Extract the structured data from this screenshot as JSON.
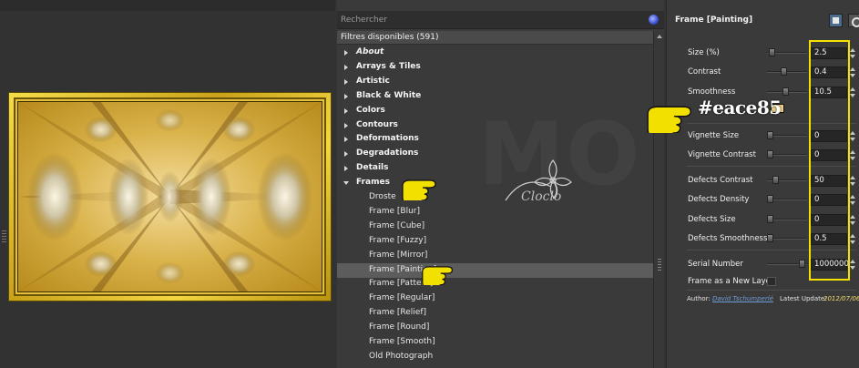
{
  "colors": {
    "accent_highlight": "#f5e000",
    "frame_gold": "#eace85",
    "link_blue": "#6f9bd8"
  },
  "filters": {
    "search_placeholder": "Rechercher",
    "header": "Filtres disponibles (591)",
    "items": [
      {
        "label": "About",
        "kind": "category",
        "italic": true
      },
      {
        "label": "Arrays & Tiles",
        "kind": "category"
      },
      {
        "label": "Artistic",
        "kind": "category"
      },
      {
        "label": "Black & White",
        "kind": "category"
      },
      {
        "label": "Colors",
        "kind": "category"
      },
      {
        "label": "Contours",
        "kind": "category"
      },
      {
        "label": "Deformations",
        "kind": "category"
      },
      {
        "label": "Degradations",
        "kind": "category"
      },
      {
        "label": "Details",
        "kind": "category"
      },
      {
        "label": "Frames",
        "kind": "category",
        "expanded": true
      },
      {
        "label": "Droste",
        "kind": "sub"
      },
      {
        "label": "Frame [Blur]",
        "kind": "sub"
      },
      {
        "label": "Frame [Cube]",
        "kind": "sub"
      },
      {
        "label": "Frame [Fuzzy]",
        "kind": "sub"
      },
      {
        "label": "Frame [Mirror]",
        "kind": "sub"
      },
      {
        "label": "Frame [Painting]",
        "kind": "sub",
        "selected": true
      },
      {
        "label": "Frame [Pattern]",
        "kind": "sub"
      },
      {
        "label": "Frame [Regular]",
        "kind": "sub"
      },
      {
        "label": "Frame [Relief]",
        "kind": "sub"
      },
      {
        "label": "Frame [Round]",
        "kind": "sub"
      },
      {
        "label": "Frame [Smooth]",
        "kind": "sub"
      },
      {
        "label": "Old Photograph",
        "kind": "sub"
      }
    ]
  },
  "watermark": {
    "text": "Cloclo"
  },
  "params": {
    "title": "Frame [Painting]",
    "color_annotation": "#eace85",
    "rows": [
      {
        "label": "Size (%)",
        "value": "2.5",
        "slider": 0.05
      },
      {
        "label": "Contrast",
        "value": "0.4",
        "slider": 0.4
      },
      {
        "label": "Smoothness",
        "value": "10.5",
        "slider": 0.45
      },
      {
        "label": "Vignette Size",
        "value": "0",
        "slider": 0.0
      },
      {
        "label": "Vignette Contrast",
        "value": "0",
        "slider": 0.0
      },
      {
        "label": "Defects Contrast",
        "value": "50",
        "slider": 0.15
      },
      {
        "label": "Defects Density",
        "value": "0",
        "slider": 0.0
      },
      {
        "label": "Defects Size",
        "value": "0",
        "slider": 0.0
      },
      {
        "label": "Defects Smoothness",
        "value": "0.5",
        "slider": 0.0
      },
      {
        "label": "Serial Number",
        "value": "1000000",
        "slider": 0.95
      }
    ],
    "new_layer_label": "Frame as a New Layer",
    "author_label": "Author:",
    "author_name": "David Tschumperlé",
    "update_label": "Latest Update:",
    "update_value": "2012/07/06"
  }
}
